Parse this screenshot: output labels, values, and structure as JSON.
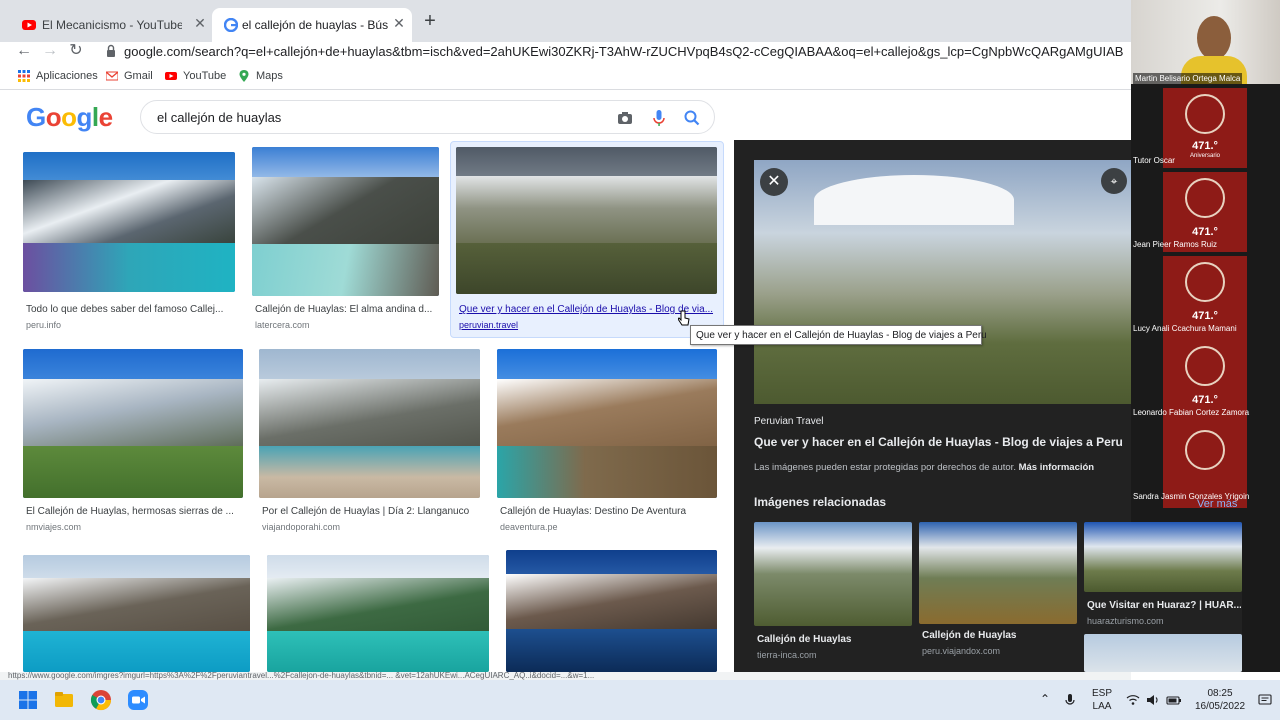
{
  "browser": {
    "tabs": [
      {
        "title": "El Mecanicismo - YouTube",
        "icon": "youtube-icon"
      },
      {
        "title": "el callejón de huaylas - Búsqueda",
        "icon": "google-icon"
      }
    ],
    "url": "google.com/search?q=el+callejón+de+huaylas&tbm=isch&ved=2ahUKEwi30ZKRj-T3AhW-rZUCHVpqB4sQ2-cCegQIABAA&oq=el+callejo&gs_lcp=CgNpbWcQARgAMgUIABCABDIFCAAQgA...",
    "bookmarks": [
      {
        "label": "Aplicaciones",
        "icon": "apps-grid-icon"
      },
      {
        "label": "Gmail",
        "icon": "gmail-icon"
      },
      {
        "label": "YouTube",
        "icon": "youtube-icon"
      },
      {
        "label": "Maps",
        "icon": "maps-pin-icon"
      }
    ],
    "status_url": "https://www.google.com/imgres?imgurl=https%3A%2F%2Fperuviantravel...%2Fcallejon-de-huaylas&tbnid=... &vet=12ahUKEwi...ACegUIARC_AQ..i&docid=...&w=1..."
  },
  "google": {
    "logo": "Google",
    "query": "el callejón de huaylas"
  },
  "results": [
    {
      "title": "Todo lo que debes saber del famoso Callej...",
      "source": "peru.info"
    },
    {
      "title": "Callejón de Huaylas: El alma andina d...",
      "source": "latercera.com"
    },
    {
      "title": "Que ver y hacer en el Callejón de Huaylas - Blog de via...",
      "source": "peruvian.travel"
    },
    {
      "title": "El Callejón de Huaylas, hermosas sierras de ...",
      "source": "nmviajes.com"
    },
    {
      "title": "Por el Callejón de Huaylas | Día 2: Llanganuco",
      "source": "viajandoporahi.com"
    },
    {
      "title": "Callejón de Huaylas: Destino De Aventura",
      "source": "deaventura.pe"
    }
  ],
  "tooltip": "Que ver y hacer en el Callejón de Huaylas - Blog de viajes a Peru",
  "preview": {
    "site": "Peruvian Travel",
    "title": "Que ver y hacer en el Callejón de Huaylas - Blog de viajes a Peru",
    "copyright": "Las imágenes pueden estar protegidas por derechos de autor.",
    "more_info": "Más información",
    "related_heading": "Imágenes relacionadas",
    "see_more": "Ver más",
    "related": [
      {
        "title": "Callejón de Huaylas",
        "source": "tierra-inca.com"
      },
      {
        "title": "Callejón de Huaylas",
        "source": "peru.viajandox.com"
      },
      {
        "title": "Que Visitar en Huaraz? | HUAR...",
        "source": "huarazturismo.com"
      }
    ]
  },
  "zoom": {
    "participants": [
      {
        "name": "Martin Belisario Ortega Malca"
      },
      {
        "name": "Tutor Oscar"
      },
      {
        "name": "Jean Pieer Ramos Ruiz"
      },
      {
        "name": "Lucy Anali Ccachura Mamani"
      },
      {
        "name": "Leonardo Fabian Cortez Zamora"
      },
      {
        "name": "Sandra Jasmin Gonzales Yrigoin"
      }
    ],
    "crest_number": "471.°",
    "crest_caption": "Aniversario"
  },
  "taskbar": {
    "lang_top": "ESP",
    "lang_bottom": "LAA",
    "time": "08:25",
    "date": "16/05/2022"
  },
  "colors": {
    "accent_blue": "#1a73e8",
    "preview_bg": "#222222",
    "crest_red": "#8e1b17"
  }
}
